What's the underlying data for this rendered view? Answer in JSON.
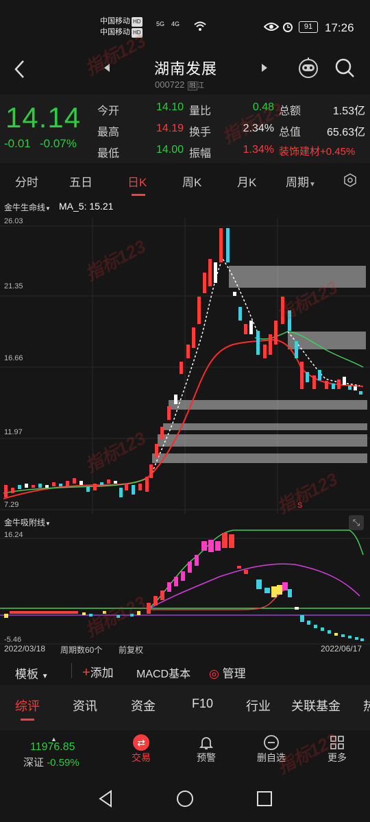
{
  "status": {
    "carrier1": "中国移动",
    "carrier2": "中国移动",
    "hd": "HD",
    "net1": "5G",
    "net2": "4G",
    "battery": "91",
    "time": "17:26"
  },
  "header": {
    "title": "湖南发展",
    "code": "000722",
    "market_badge": "融",
    "tag": "江"
  },
  "quote": {
    "price": "14.14",
    "change": "-0.01",
    "change_pct": "-0.07%",
    "labels": {
      "open": "今开",
      "high": "最高",
      "low": "最低",
      "vol_ratio": "量比",
      "turnover": "换手",
      "amplitude": "振幅",
      "amount": "总额",
      "mktcap": "总值",
      "sector": "装饰建材"
    },
    "open": "14.10",
    "high": "14.19",
    "low": "14.00",
    "vol_ratio": "0.48",
    "turnover": "2.34%",
    "amplitude": "1.34%",
    "amount": "1.53亿",
    "mktcap": "65.63亿",
    "sector_change": "+0.45%"
  },
  "tabs": [
    "分时",
    "五日",
    "日K",
    "周K",
    "月K",
    "周期"
  ],
  "chart": {
    "main_indicator": "金牛生命线",
    "ma_label": "MA_5: 15.21",
    "y_ticks": [
      "26.03",
      "21.35",
      "16.66",
      "11.97",
      "7.29"
    ],
    "marker_s": "S",
    "sub_indicator": "金牛吸附线",
    "sub_y_top": "16.24",
    "sub_y_bottom": "-5.46",
    "date_start": "2022/03/18",
    "period_count": "周期数60个",
    "adjust": "前复权",
    "date_end": "2022/06/17"
  },
  "chart_data": {
    "type": "candlestick",
    "ylim": [
      7.29,
      26.03
    ],
    "x_range": [
      "2022/03/18",
      "2022/06/17"
    ],
    "periods": 60,
    "ma5_last": 15.21,
    "last_close": 14.14
  },
  "toolbar": {
    "template": "模板",
    "add": "添加",
    "macd": "MACD基本",
    "manage": "管理"
  },
  "bottom_tabs": [
    "综评",
    "资讯",
    "资金",
    "F10",
    "行业",
    "关联基金",
    "热"
  ],
  "bottom_nav": {
    "index_value": "11976.85",
    "index_name": "深证",
    "index_change": "-0.59%",
    "items": [
      "交易",
      "预警",
      "删自选",
      "更多"
    ]
  },
  "watermark": "指标123"
}
